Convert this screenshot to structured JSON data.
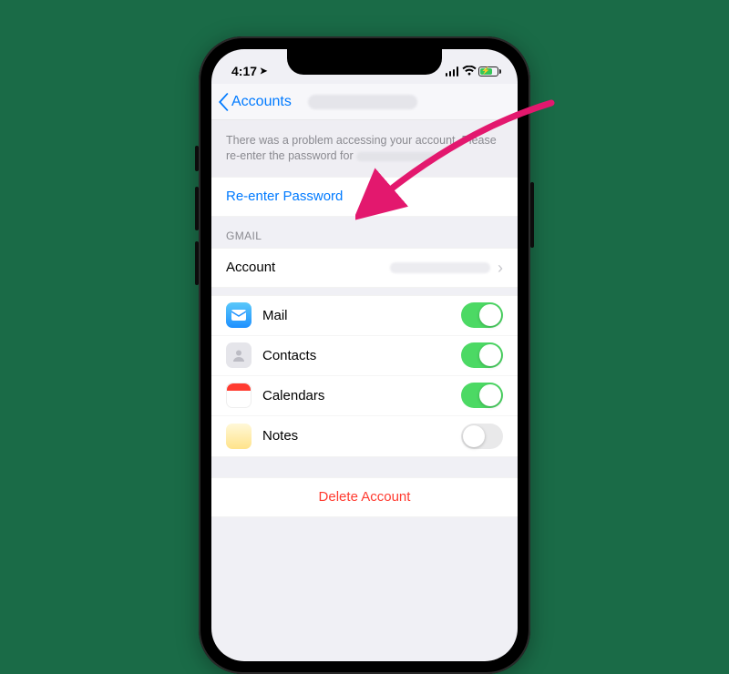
{
  "status": {
    "time": "4:17",
    "location_arrow": "➤",
    "battery_charging": true
  },
  "nav": {
    "back_label": "Accounts"
  },
  "error": {
    "line1": "There was a problem accessing your account. Please",
    "line2_prefix": "re-enter the password for"
  },
  "reenter": {
    "label": "Re-enter Password"
  },
  "account_section": {
    "header": "GMAIL",
    "row_label": "Account"
  },
  "services": [
    {
      "key": "mail",
      "label": "Mail",
      "on": true
    },
    {
      "key": "contacts",
      "label": "Contacts",
      "on": true
    },
    {
      "key": "calendars",
      "label": "Calendars",
      "on": true
    },
    {
      "key": "notes",
      "label": "Notes",
      "on": false
    }
  ],
  "delete": {
    "label": "Delete Account"
  }
}
